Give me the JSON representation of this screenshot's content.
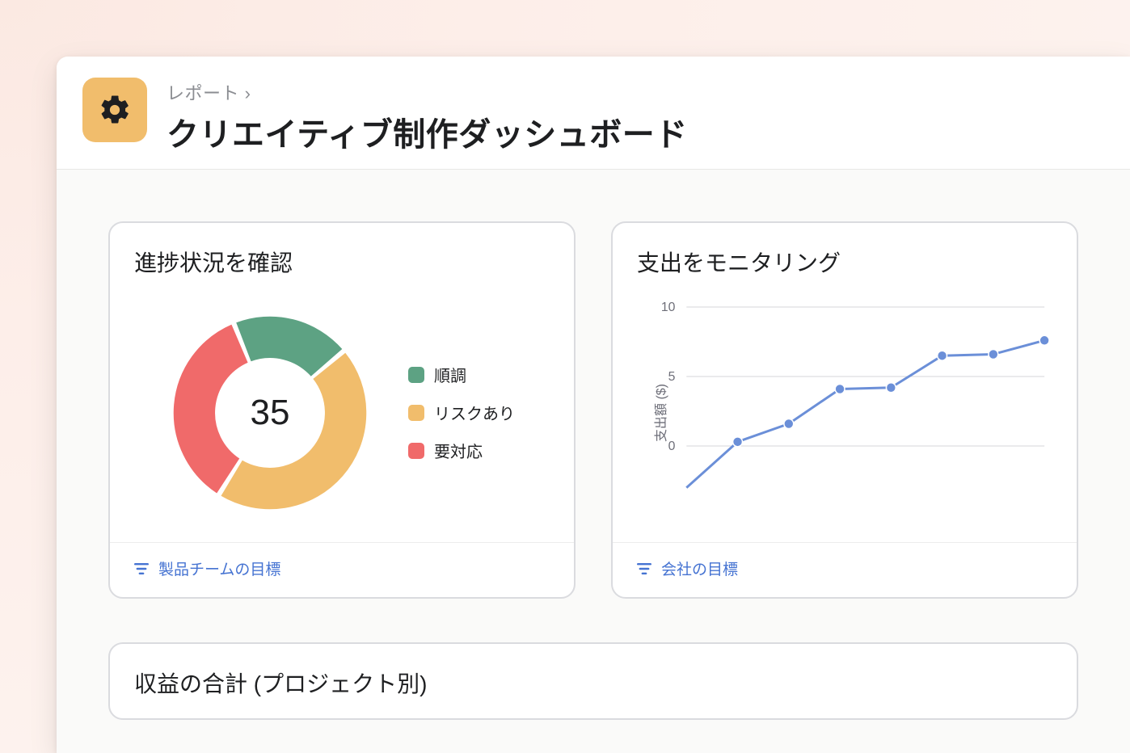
{
  "header": {
    "breadcrumb": "レポート ›",
    "title": "クリエイティブ制作ダッシュボード",
    "icon": "gear-icon"
  },
  "cards": {
    "progress": {
      "title": "進捗状況を確認",
      "center_value": "35",
      "legend": [
        {
          "label": "順調",
          "color": "#5da283"
        },
        {
          "label": "リスクあり",
          "color": "#f1bd6c"
        },
        {
          "label": "要対応",
          "color": "#f06a6a"
        }
      ],
      "footer": "製品チームの目標"
    },
    "spend": {
      "title": "支出をモニタリング",
      "ylabel": "支出額 ($)",
      "footer": "会社の目標",
      "yticks": [
        "0",
        "5",
        "10"
      ]
    },
    "revenue": {
      "title": "収益の合計 (プロジェクト別)"
    }
  },
  "colors": {
    "accent_blue": "#4573d2",
    "line_blue": "#6b8fd8",
    "green": "#5da283",
    "amber": "#f1bd6c",
    "red": "#f06a6a"
  },
  "chart_data": [
    {
      "type": "pie",
      "title": "進捗状況を確認",
      "center_label": 35,
      "series": [
        {
          "name": "順調",
          "value": 20
        },
        {
          "name": "リスクあり",
          "value": 45
        },
        {
          "name": "要対応",
          "value": 35
        }
      ]
    },
    {
      "type": "line",
      "title": "支出をモニタリング",
      "ylabel": "支出額 ($)",
      "ylim": [
        -5,
        10
      ],
      "x": [
        1,
        2,
        3,
        4,
        5,
        6,
        7,
        8
      ],
      "values": [
        -3.0,
        0.3,
        1.6,
        4.1,
        4.2,
        6.5,
        6.6,
        7.6
      ]
    }
  ]
}
